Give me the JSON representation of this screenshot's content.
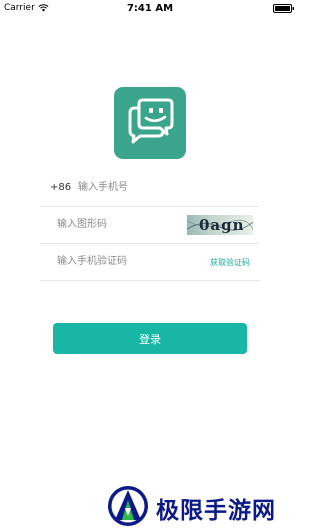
{
  "status_bar": {
    "carrier": "Carrier",
    "time": "7:41 AM"
  },
  "form": {
    "country_code": "+86",
    "phone_placeholder": "输入手机号",
    "captcha_placeholder": "输入图形码",
    "captcha_text": "0agn",
    "sms_placeholder": "输入手机验证码",
    "get_code_label": "获取验证码"
  },
  "login_label": "登录",
  "watermark": {
    "text": "极限手游网"
  },
  "colors": {
    "accent": "#18b6a4",
    "logo_bg": "#3aa58c",
    "link": "#1faa95",
    "watermark": "#0b1a88"
  }
}
